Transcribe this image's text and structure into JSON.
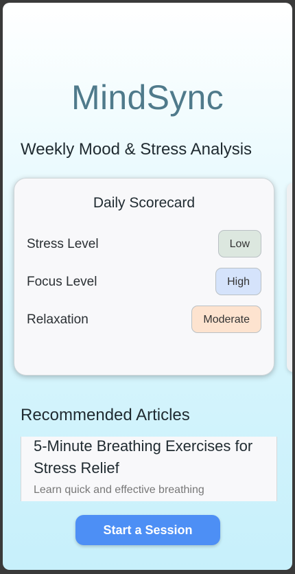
{
  "app": {
    "title": "MindSync"
  },
  "weekly": {
    "title": "Weekly Mood & Stress Analysis"
  },
  "scorecard": {
    "title": "Daily Scorecard",
    "metrics": [
      {
        "label": "Stress Level",
        "value": "Low"
      },
      {
        "label": "Focus Level",
        "value": "High"
      },
      {
        "label": "Relaxation",
        "value": "Moderate"
      }
    ]
  },
  "articles": {
    "title": "Recommended Articles",
    "items": [
      {
        "title": "5-Minute Breathing Exercises for Stress Relief",
        "description": "Learn quick and effective breathing"
      }
    ]
  },
  "cta": {
    "label": "Start a Session"
  },
  "colors": {
    "brand": "#4f7a8b",
    "accent": "#4d8ff5",
    "badge_low": "#dce7df",
    "badge_high": "#d5e3fb",
    "badge_moderate": "#fde3cf"
  }
}
